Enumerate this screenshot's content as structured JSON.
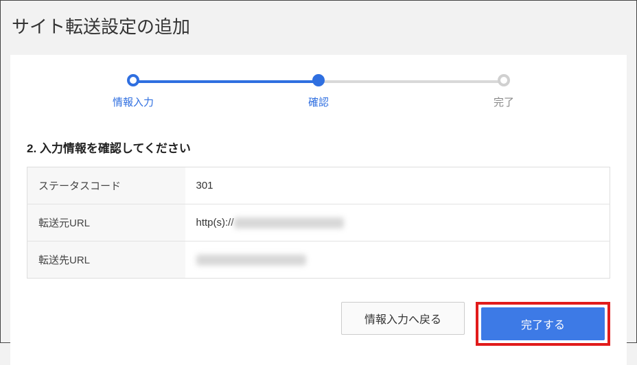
{
  "page": {
    "title": "サイト転送設定の追加"
  },
  "stepper": {
    "steps": [
      {
        "label": "情報入力",
        "state": "done"
      },
      {
        "label": "確認",
        "state": "active"
      },
      {
        "label": "完了",
        "state": "todo"
      }
    ]
  },
  "section": {
    "heading": "2. 入力情報を確認してください"
  },
  "confirm": {
    "rows": [
      {
        "label": "ステータスコード",
        "value": "301"
      },
      {
        "label": "転送元URL",
        "value": "http(s)://",
        "redacted_suffix": true
      },
      {
        "label": "転送先URL",
        "value": "",
        "redacted_suffix": true
      }
    ]
  },
  "actions": {
    "back_label": "情報入力へ戻る",
    "submit_label": "完了する"
  }
}
